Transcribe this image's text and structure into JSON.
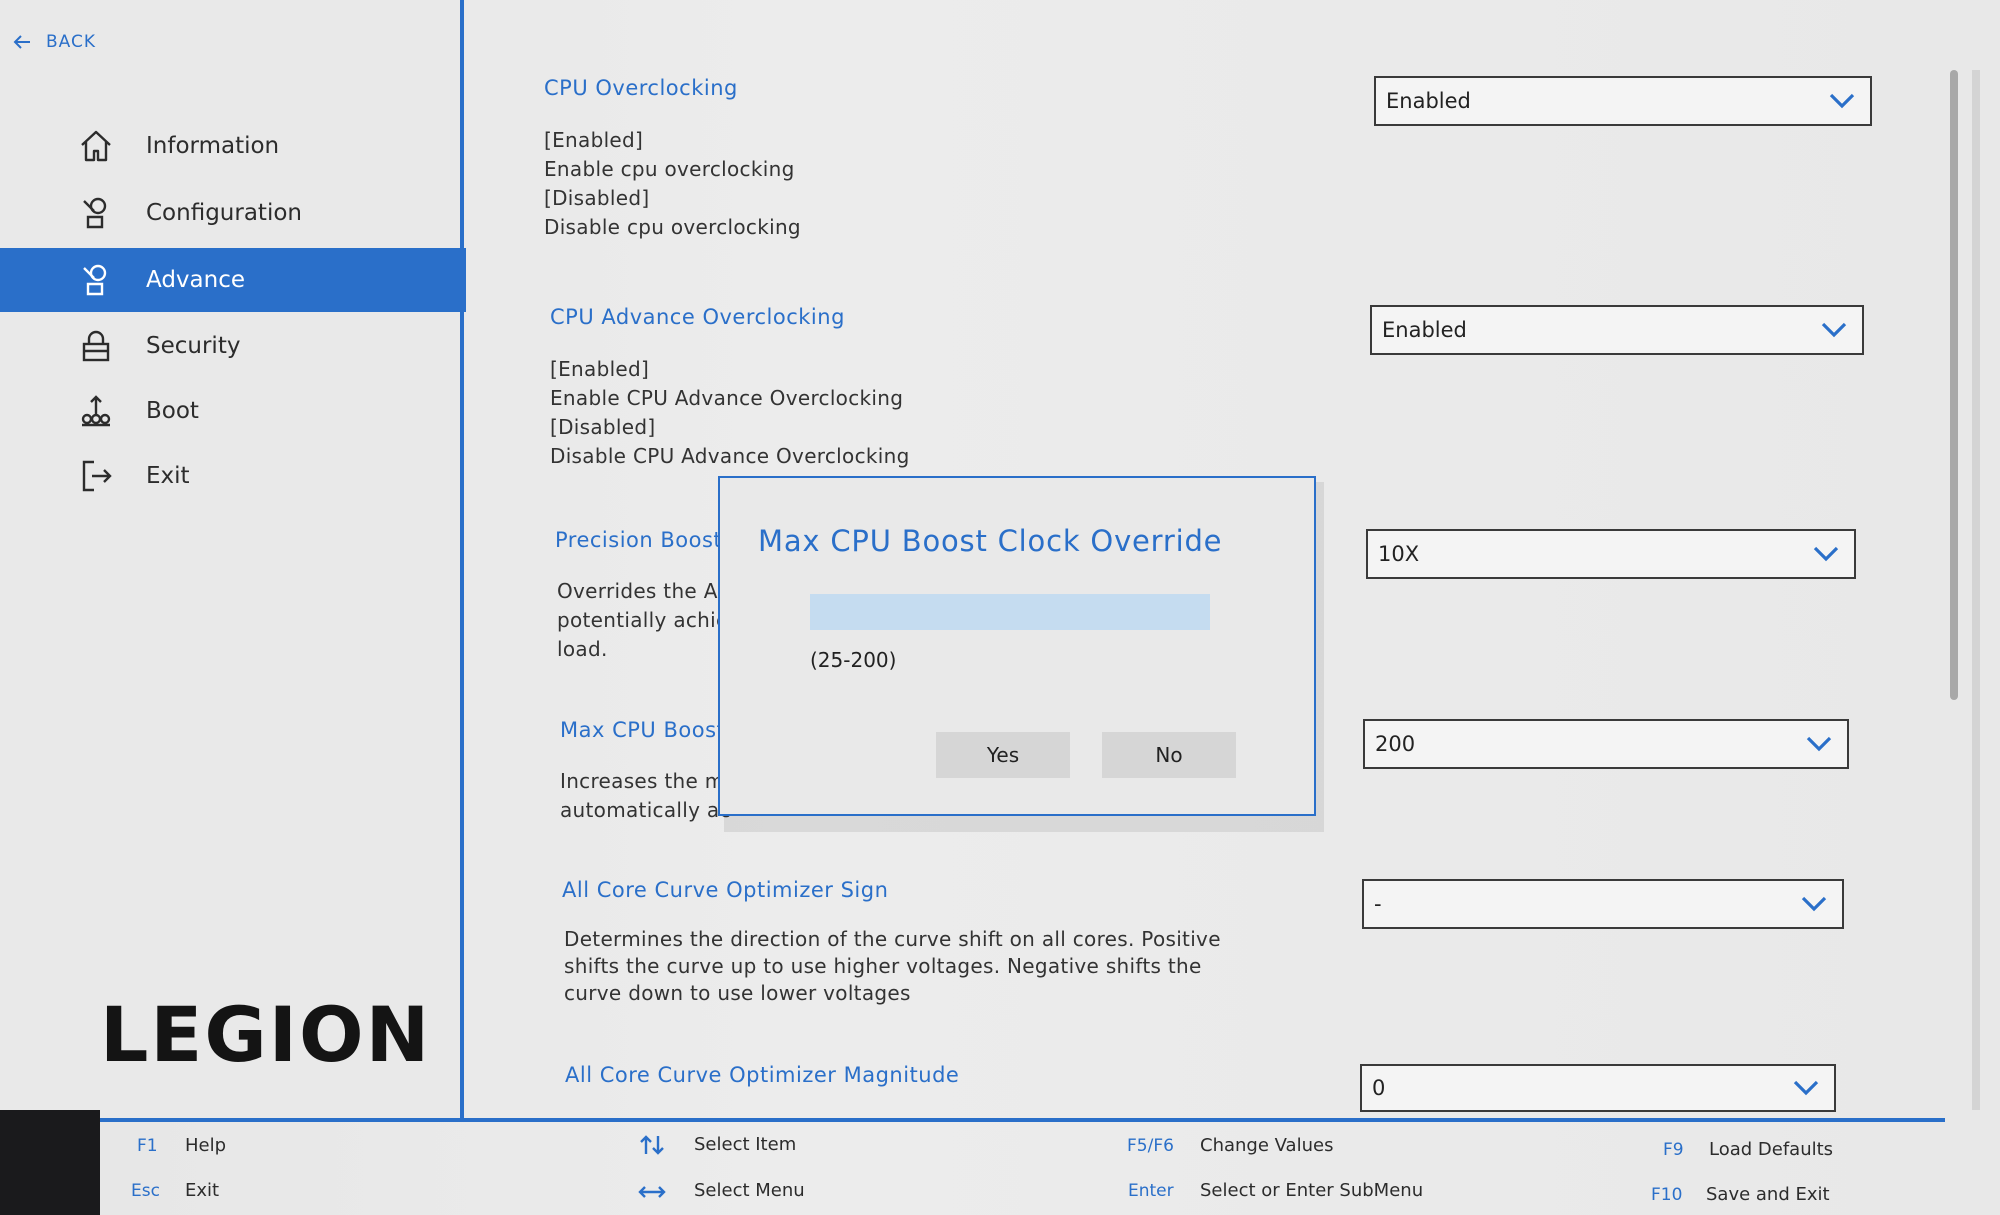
{
  "nav": {
    "back_label": "BACK",
    "items": [
      {
        "label": "Information",
        "icon": "home-icon"
      },
      {
        "label": "Configuration",
        "icon": "configuration-icon"
      },
      {
        "label": "Advance",
        "icon": "advance-icon"
      },
      {
        "label": "Security",
        "icon": "lock-icon"
      },
      {
        "label": "Boot",
        "icon": "boot-icon"
      },
      {
        "label": "Exit",
        "icon": "exit-icon"
      }
    ],
    "active": "Advance"
  },
  "brand": {
    "logo_text": "LEGION"
  },
  "settings": [
    {
      "title": "CPU Overclocking",
      "description": "[Enabled]\nEnable cpu overclocking\n[Disabled]\nDisable cpu overclocking",
      "value": "Enabled"
    },
    {
      "title": "CPU Advance Overclocking",
      "description": "[Enabled]\nEnable CPU Advance Overclocking\n[Disabled]\nDisable CPU Advance Overclocking",
      "value": "Enabled"
    },
    {
      "title": "Precision Boost",
      "description": "Overrides the A\npotentially achie\nload.",
      "value": "10X"
    },
    {
      "title": "Max CPU Boost",
      "description": "Increases the m\nautomatically ac",
      "value": "200"
    },
    {
      "title": "All Core Curve Optimizer Sign",
      "description": "Determines the direction of the curve shift on all cores. Positive\nshifts the curve up to use higher voltages. Negative shifts the\ncurve down to use lower voltages",
      "value": "-"
    },
    {
      "title": "All Core Curve Optimizer Magnitude",
      "description": "",
      "value": "0"
    }
  ],
  "dialog": {
    "title": "Max CPU Boost Clock Override",
    "input_value": "",
    "range": "(25-200)",
    "yes_label": "Yes",
    "no_label": "No"
  },
  "footer": {
    "f1_key": "F1",
    "f1_desc": "Help",
    "esc_key": "Esc",
    "esc_desc": "Exit",
    "select_item": "Select Item",
    "select_menu": "Select Menu",
    "f5f6_key": "F5/F6",
    "f5f6_desc": "Change Values",
    "enter_key": "Enter",
    "enter_desc": "Select or Enter SubMenu",
    "f9_key": "F9",
    "f9_desc": "Load Defaults",
    "f10_key": "F10",
    "f10_desc": "Save and Exit"
  },
  "colors": {
    "accent": "#2a6fc9",
    "background": "#e8e8e8",
    "input_fill": "#c5dcf0"
  }
}
